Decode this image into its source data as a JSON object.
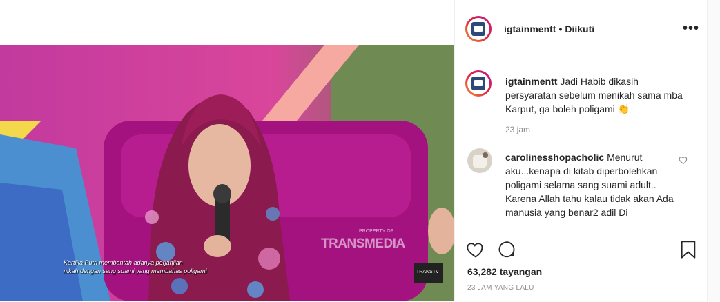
{
  "header": {
    "username": "igtainmentt",
    "separator": "•",
    "follow_status": "Diikuti",
    "more_label": "•••"
  },
  "caption": {
    "username": "igtainmentt",
    "text": "Jadi Habib dikasih persyaratan sebelum menikah sama mba Karput, ga boleh poligami 👏",
    "time": "23 jam"
  },
  "comment": {
    "username": "carolinesshopacholic",
    "text": "Menurut aku...kenapa di kitab diperbolehkan poligami selama sang suami adult.. Karena Allah tahu kalau tidak akan Ada manusia yang benar2 adil Di"
  },
  "video": {
    "subtitle_line1": "Kartika Putri membantah adanya perjanjian",
    "subtitle_line2": "nikah dengan sang suami yang membahas poligami",
    "watermark_small": "PROPERTY OF",
    "watermark": "TRANSMEDIA",
    "channel_logo": "TRANSTV"
  },
  "stats": {
    "views": "63,282 tayangan",
    "posted": "23 JAM YANG LALU"
  },
  "icons": {
    "like": "heart-icon",
    "comment": "comment-bubble-icon",
    "save": "bookmark-icon",
    "options": "more-options-icon"
  }
}
